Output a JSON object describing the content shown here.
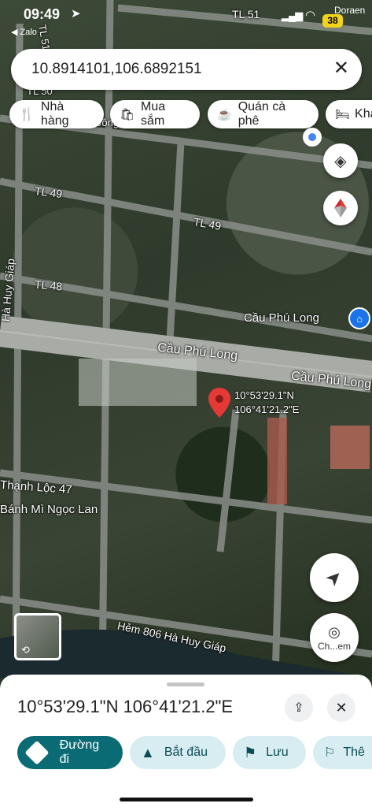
{
  "status": {
    "time": "09:49",
    "back_app": "Zalo",
    "carrier": "Doraen",
    "battery": "38"
  },
  "search": {
    "query": "10.8914101,106.6892151"
  },
  "chips": [
    {
      "label": "Nhà hàng",
      "icon": "fork-knife-icon"
    },
    {
      "label": "Mua sắm",
      "icon": "shopping-bag-icon"
    },
    {
      "label": "Quán cà phê",
      "icon": "coffee-cup-icon"
    },
    {
      "label": "Khá",
      "icon": "bed-icon"
    }
  ],
  "map_labels": {
    "tl51a": "TL 51",
    "tl51b": "TL 51",
    "tl50": "TL 50",
    "tl49a": "TL 49",
    "tl49b": "TL 49",
    "tl48": "TL 48",
    "ha_huy_giap": "Hà Huy Giáp",
    "cau_phu_long_poi": "Cầu Phú Long",
    "cau_phu_long_1": "Cầu Phú Long",
    "cau_phu_long_2": "Cầu Phú Long",
    "thanh_loc": "Thạnh Lộc 47",
    "banh_mi": "Bánh Mì Ngọc Lan",
    "hem806": "Hẻm 806 Hà Huy Giáp",
    "pin_lat": "10°53'29.1\"N",
    "pin_lng": "106°41'21.2\"E",
    "top_partial": "Công"
  },
  "controls": {
    "camera_label": "Ch...em"
  },
  "sheet": {
    "coords": "10°53'29.1\"N 106°41'21.2\"E",
    "directions": "Đường đi",
    "start": "Bắt đầu",
    "save": "Lưu",
    "more": "Thê"
  },
  "colors": {
    "accent": "#0b6b75",
    "pin": "#e53935",
    "chip_tint": "#d8edf1"
  }
}
